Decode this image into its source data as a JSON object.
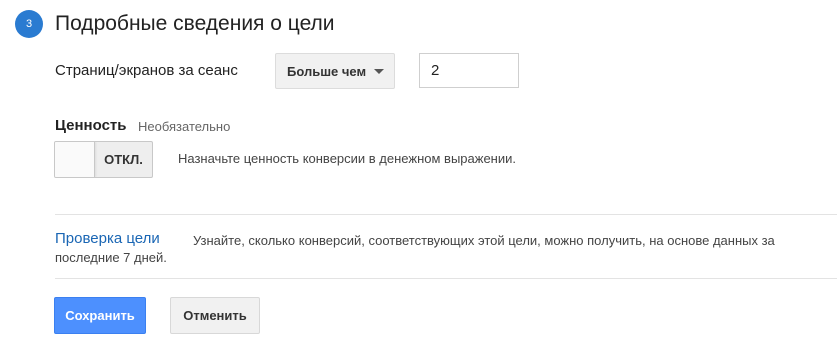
{
  "section": {
    "step_number": "3",
    "title": "Подробные сведения о цели"
  },
  "pages_condition": {
    "label": "Страниц/экранов за сеанс",
    "operator_selected": "Больше чем",
    "value": "2"
  },
  "value_setting": {
    "label": "Ценность",
    "optional_text": "Необязательно",
    "toggle_state": "ОТКЛ.",
    "hint": "Назначьте ценность конверсии в денежном выражении."
  },
  "verify": {
    "link_label": "Проверка цели",
    "description_line1": "Узнайте, сколько конверсий, соответствующих этой цели, можно получить, на основе данных за",
    "description_line2": "последние 7 дней."
  },
  "actions": {
    "save_label": "Сохранить",
    "cancel_label": "Отменить"
  },
  "colors": {
    "accent": "#2a7bd1",
    "primary_button": "#4d90fe",
    "link": "#1a66b4"
  },
  "icons": {
    "dropdown": "caret-down-icon"
  }
}
